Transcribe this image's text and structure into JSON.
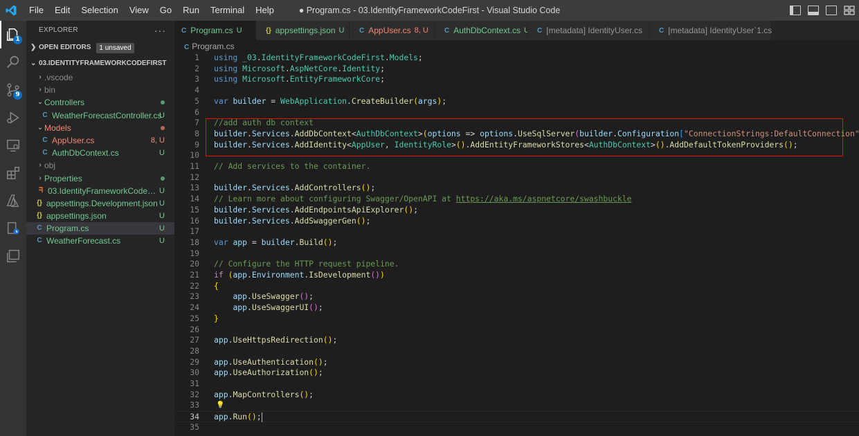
{
  "titlebar": {
    "menu": [
      "File",
      "Edit",
      "Selection",
      "View",
      "Go",
      "Run",
      "Terminal",
      "Help"
    ],
    "window_title": "● Program.cs - 03.IdentityFrameworkCodeFirst - Visual Studio Code"
  },
  "activitybar": {
    "explorer_badge": "1",
    "scm_badge": "9"
  },
  "sidebar": {
    "title": "EXPLORER",
    "more": "···",
    "open_editors": {
      "label": "OPEN EDITORS",
      "badge": "1 unsaved"
    },
    "project": {
      "label": "03.IDENTITYFRAMEWORKCODEFIRST"
    },
    "tree": [
      {
        "label": ".vscode",
        "decor": ""
      },
      {
        "label": "bin",
        "decor": ""
      },
      {
        "label": "Controllers",
        "decor": ""
      },
      {
        "label": "WeatherForecastController.cs",
        "decor": "U"
      },
      {
        "label": "Models",
        "decor": ""
      },
      {
        "label": "AppUser.cs",
        "decor": "8, U"
      },
      {
        "label": "AuthDbContext.cs",
        "decor": "U"
      },
      {
        "label": "obj",
        "decor": ""
      },
      {
        "label": "Properties",
        "decor": ""
      },
      {
        "label": "03.IdentityFrameworkCodeFirst....",
        "decor": "U"
      },
      {
        "label": "appsettings.Development.json",
        "decor": "U"
      },
      {
        "label": "appsettings.json",
        "decor": "U"
      },
      {
        "label": "Program.cs",
        "decor": "U"
      },
      {
        "label": "WeatherForecast.cs",
        "decor": "U"
      }
    ]
  },
  "tabs": [
    {
      "label": "Program.cs",
      "decor": "U"
    },
    {
      "label": "appsettings.json",
      "decor": "U"
    },
    {
      "label": "AppUser.cs",
      "decor": "8, U"
    },
    {
      "label": "AuthDbContext.cs",
      "decor": "U"
    },
    {
      "label": "[metadata] IdentityUser.cs",
      "decor": ""
    },
    {
      "label": "[metadata] IdentityUser`1.cs",
      "decor": ""
    }
  ],
  "breadcrumb": {
    "file": "Program.cs"
  },
  "colors": {
    "accent": "#0e70c0",
    "highlight_box": "#e51400",
    "untracked": "#73c991",
    "error": "#f48771"
  },
  "editor": {
    "line_numbers": [
      "1",
      "2",
      "3",
      "4",
      "5",
      "6",
      "7",
      "8",
      "9",
      "10",
      "11",
      "12",
      "13",
      "14",
      "15",
      "16",
      "17",
      "18",
      "19",
      "20",
      "21",
      "22",
      "23",
      "24",
      "25",
      "26",
      "27",
      "28",
      "29",
      "30",
      "31",
      "32",
      "33",
      "34",
      "35"
    ],
    "url": "https://aka.ms/aspnetcore/swashbuckle",
    "connection_string": "\"ConnectionStrings:DefaultConnection\""
  }
}
